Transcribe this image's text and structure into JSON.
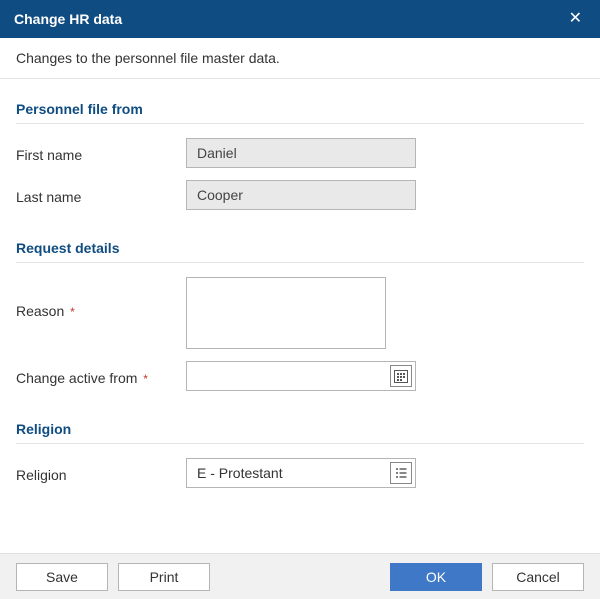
{
  "dialog": {
    "title": "Change HR data",
    "description": "Changes to the personnel file master data."
  },
  "sections": {
    "personnel_file": {
      "header": "Personnel file from",
      "first_name_label": "First name",
      "first_name_value": "Daniel",
      "last_name_label": "Last name",
      "last_name_value": "Cooper"
    },
    "request_details": {
      "header": "Request details",
      "reason_label": "Reason",
      "reason_value": "",
      "change_from_label": "Change active from",
      "change_from_value": ""
    },
    "religion": {
      "header": "Religion",
      "religion_label": "Religion",
      "religion_value": "E - Protestant"
    }
  },
  "buttons": {
    "save": "Save",
    "print": "Print",
    "ok": "OK",
    "cancel": "Cancel"
  },
  "required_marker": "*"
}
